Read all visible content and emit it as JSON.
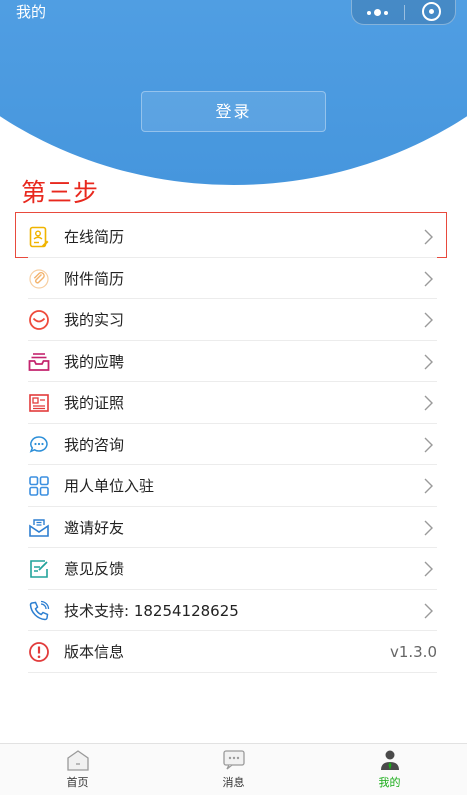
{
  "header": {
    "title": "我的",
    "menu_icon": "more-dots-icon",
    "close_icon": "target-icon",
    "bg_color": "#5aa6e8"
  },
  "login": {
    "label": "登录"
  },
  "annotation": {
    "step_text": "第三步",
    "color": "#e8281e"
  },
  "menu": {
    "items": [
      {
        "label": "在线简历",
        "icon": "resume-icon",
        "color": "#f0b400"
      },
      {
        "label": "附件简历",
        "icon": "paperclip-icon",
        "color": "#f3b36d"
      },
      {
        "label": "我的实习",
        "icon": "smile-icon",
        "color": "#ee4b3c"
      },
      {
        "label": "我的应聘",
        "icon": "inbox-icon",
        "color": "#c4246e"
      },
      {
        "label": "我的证照",
        "icon": "certificate-icon",
        "color": "#e23b3b"
      },
      {
        "label": "我的咨询",
        "icon": "chat-bubble-icon",
        "color": "#2d8fd8"
      },
      {
        "label": "用人单位入驻",
        "icon": "grid-apps-icon",
        "color": "#3b8fe0"
      },
      {
        "label": "邀请好友",
        "icon": "envelope-icon",
        "color": "#2e7fd1"
      },
      {
        "label": "意见反馈",
        "icon": "edit-feedback-icon",
        "color": "#22a39b"
      },
      {
        "label": "技术支持: 18254128625",
        "icon": "phone-icon",
        "color": "#2d7fd1"
      },
      {
        "label": "版本信息",
        "icon": "info-circle-icon",
        "color": "#e23b3b",
        "value": "v1.3.0"
      }
    ]
  },
  "tabbar": {
    "tabs": [
      {
        "label": "首页",
        "icon": "home-icon"
      },
      {
        "label": "消息",
        "icon": "message-icon"
      },
      {
        "label": "我的",
        "icon": "profile-icon",
        "active": true
      }
    ],
    "active_color": "#1aad19"
  }
}
